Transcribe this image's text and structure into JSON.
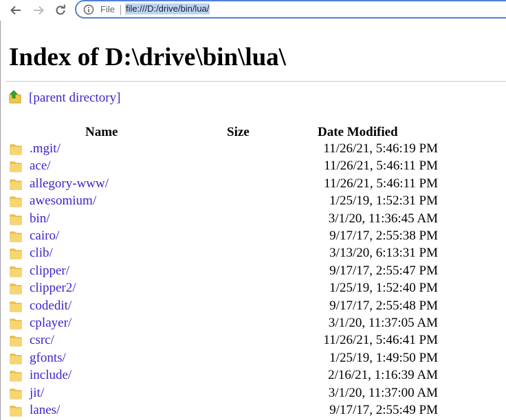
{
  "browser": {
    "scheme_label": "File",
    "url": "file:///D:/drive/bin/lua/"
  },
  "page": {
    "title": "Index of D:\\drive\\bin\\lua\\",
    "parent_link": "[parent directory]",
    "columns": {
      "name": "Name",
      "size": "Size",
      "date": "Date Modified"
    },
    "entries": [
      {
        "name": ".mgit/",
        "date": "11/26/21, 5:46:19 PM"
      },
      {
        "name": "ace/",
        "date": "11/26/21, 5:46:11 PM"
      },
      {
        "name": "allegory-www/",
        "date": "11/26/21, 5:46:11 PM"
      },
      {
        "name": "awesomium/",
        "date": "1/25/19, 1:52:31 PM"
      },
      {
        "name": "bin/",
        "date": "3/1/20, 11:36:45 AM"
      },
      {
        "name": "cairo/",
        "date": "9/17/17, 2:55:38 PM"
      },
      {
        "name": "clib/",
        "date": "3/13/20, 6:13:31 PM"
      },
      {
        "name": "clipper/",
        "date": "9/17/17, 2:55:47 PM"
      },
      {
        "name": "clipper2/",
        "date": "1/25/19, 1:52:40 PM"
      },
      {
        "name": "codedit/",
        "date": "9/17/17, 2:55:48 PM"
      },
      {
        "name": "cplayer/",
        "date": "3/1/20, 11:37:05 AM"
      },
      {
        "name": "csrc/",
        "date": "11/26/21, 5:46:41 PM"
      },
      {
        "name": "gfonts/",
        "date": "1/25/19, 1:49:50 PM"
      },
      {
        "name": "include/",
        "date": "2/16/21, 1:16:39 AM"
      },
      {
        "name": "jit/",
        "date": "3/1/20, 11:37:00 AM"
      },
      {
        "name": "lanes/",
        "date": "9/17/17, 2:55:49 PM"
      }
    ]
  },
  "colors": {
    "link": "#3a26c8",
    "folder": "#f2c64d",
    "url_highlight": "#bcd4f5",
    "omnibox_border": "#4f7fd6"
  }
}
